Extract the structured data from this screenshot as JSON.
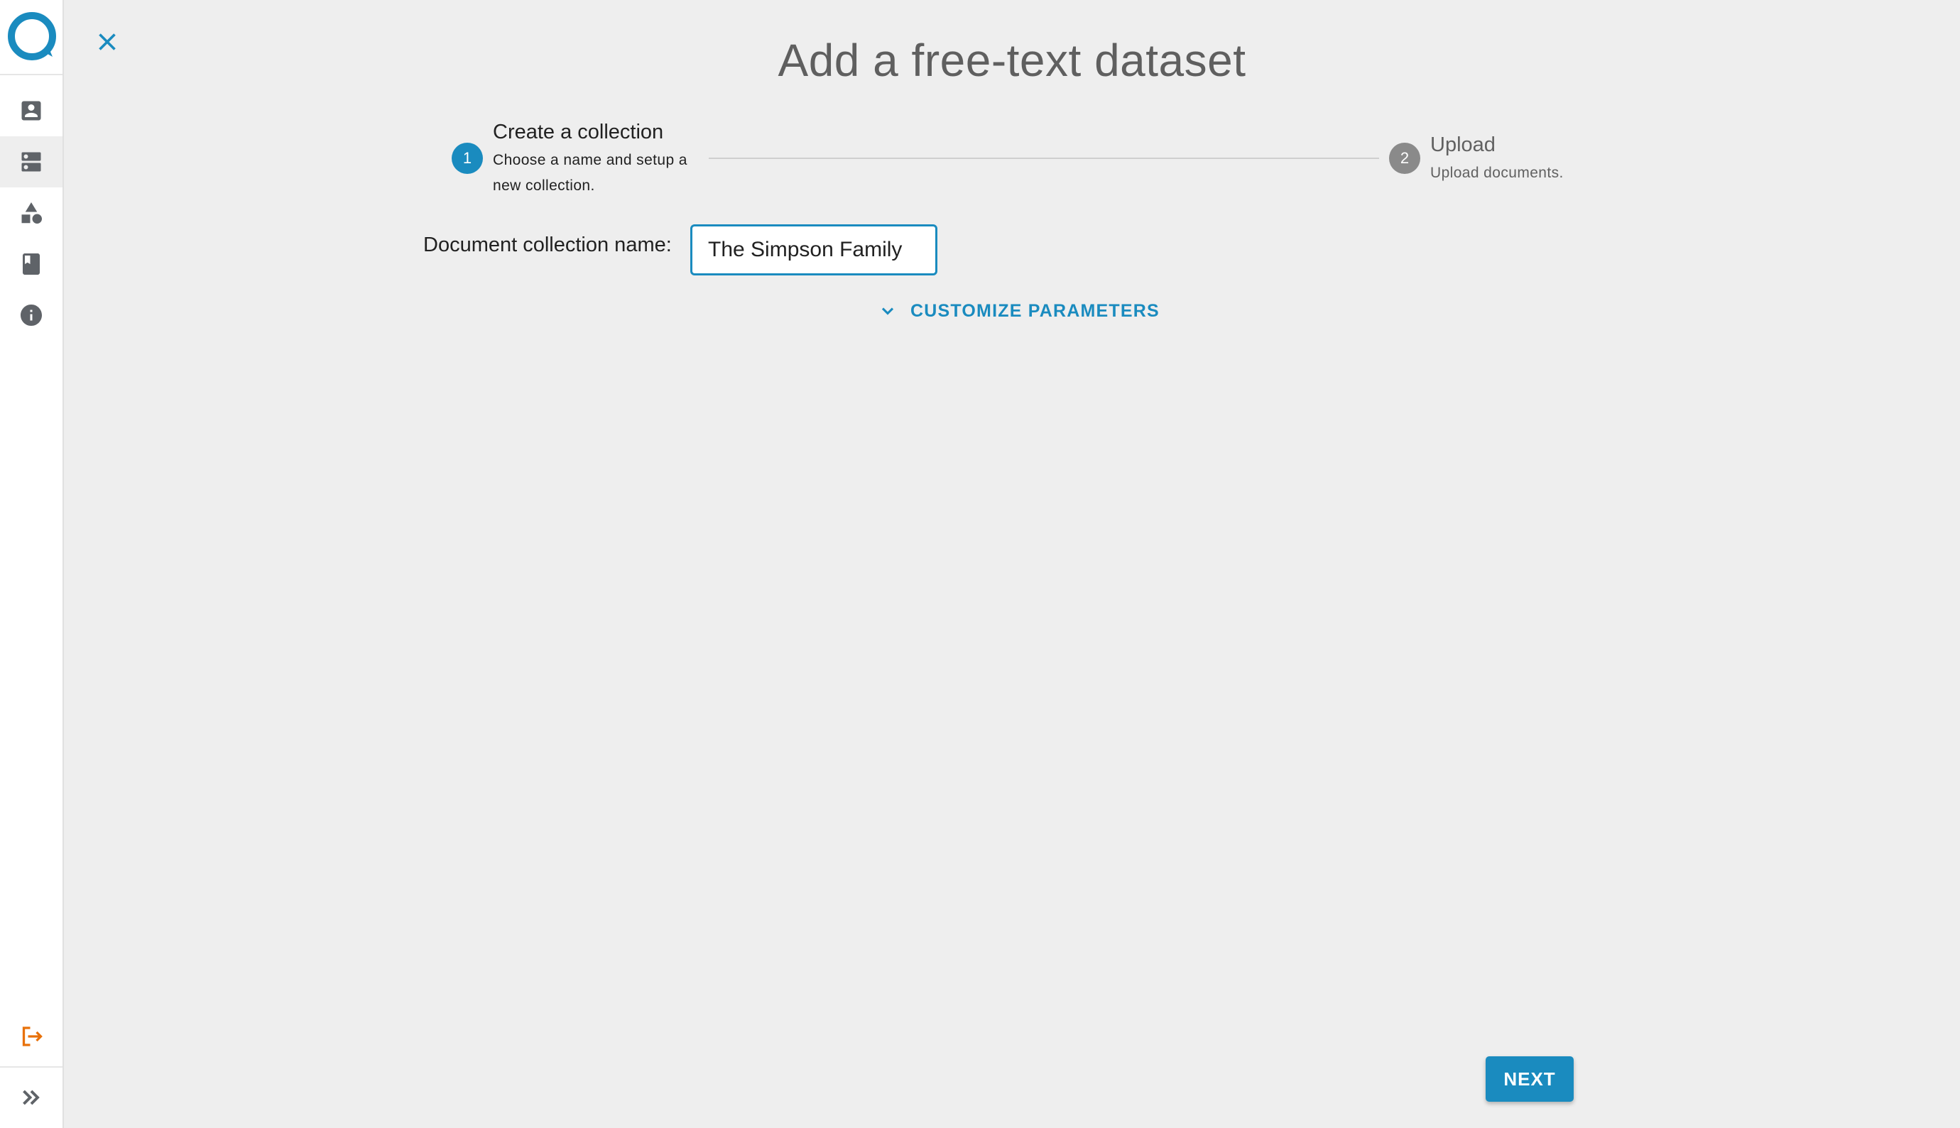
{
  "page": {
    "title": "Add a free-text dataset"
  },
  "sidebar": {
    "logo_icon": "app-logo-ring",
    "items": [
      {
        "icon": "account-box-icon",
        "active": false
      },
      {
        "icon": "dns-server-icon",
        "active": true
      },
      {
        "icon": "shapes-category-icon",
        "active": false
      },
      {
        "icon": "book-icon",
        "active": false
      },
      {
        "icon": "info-icon",
        "active": false
      }
    ],
    "logout_icon": "logout-icon",
    "expand_icon": "double-chevron-right-icon"
  },
  "stepper": {
    "steps": [
      {
        "number": "1",
        "title": "Create a collection",
        "description": "Choose a name and setup a new collection.",
        "description_line1": "Choose a name and setup a",
        "description_line2": "new collection.",
        "active": true
      },
      {
        "number": "2",
        "title": "Upload",
        "description": "Upload documents.",
        "active": false
      }
    ]
  },
  "form": {
    "collection_name_label": "Document collection name:",
    "collection_name_value": "The Simpson Family",
    "customize_label": "CUSTOMIZE PARAMETERS"
  },
  "actions": {
    "next_label": "NEXT"
  },
  "colors": {
    "accent": "#1a8bbf",
    "logout": "#e8710a",
    "icon_gray": "#5f6368",
    "background": "#eeeeee"
  }
}
